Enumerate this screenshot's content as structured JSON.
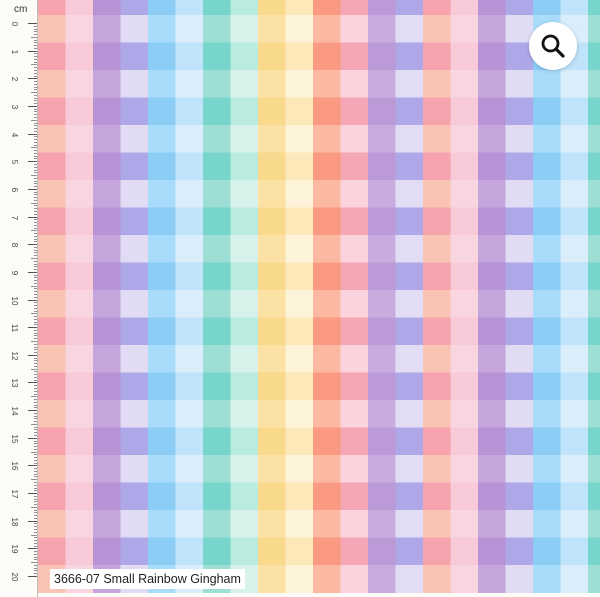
{
  "ruler": {
    "unit": "cm",
    "labels": [
      "0",
      "1",
      "2",
      "3",
      "4",
      "5",
      "6",
      "7",
      "8",
      "9",
      "10",
      "11",
      "12",
      "13",
      "14",
      "15",
      "16",
      "17",
      "18",
      "19",
      "20"
    ]
  },
  "fabric": {
    "pattern_name": "Small Rainbow Gingham",
    "background_color": "#fdfbf7",
    "stripe_colors": [
      {
        "pair": "peach-pink",
        "vertical": [
          "#f9c4b4",
          "#f8c8d8"
        ],
        "horizontal": [
          "#f6a3ad",
          "#f8cad7"
        ]
      },
      {
        "pair": "purple-lavender",
        "vertical": [
          "#c4a6dc",
          "#d8d2f2"
        ],
        "horizontal": [
          "#b793d6",
          "#aea8e8"
        ]
      },
      {
        "pair": "blue",
        "vertical": [
          "#a9dcfa",
          "#cde9fb"
        ],
        "horizontal": [
          "#8ccdf5",
          "#bfe3fb"
        ]
      },
      {
        "pair": "teal-mint",
        "vertical": [
          "#9edfd5",
          "#caefe7"
        ],
        "horizontal": [
          "#78d5cc",
          "#b9ebdf"
        ]
      },
      {
        "pair": "yellow",
        "vertical": [
          "#fbe1a3",
          "#fdf0cd"
        ],
        "horizontal": [
          "#f9d98c",
          "#fde8b9"
        ]
      },
      {
        "pair": "orange-pink",
        "vertical": [
          "#fdb8a2",
          "#f9c6d4"
        ],
        "horizontal": [
          "#fa9a83",
          "#f5a6b5"
        ]
      },
      {
        "pair": "purple-lavender-2",
        "vertical": [
          "#c9acdf",
          "#d9d3f3"
        ],
        "horizontal": [
          "#bc9ad8",
          "#aea7e8"
        ]
      }
    ]
  },
  "zoom": {
    "icon": "magnifier-icon"
  },
  "caption": {
    "text": "3666-07 Small Rainbow Gingham"
  }
}
